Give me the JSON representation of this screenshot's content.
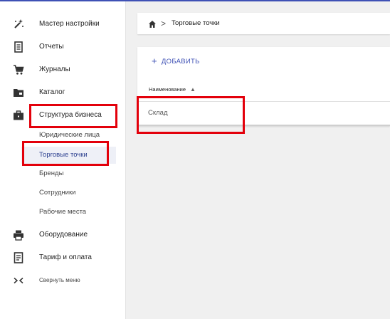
{
  "sidebar": {
    "items": [
      {
        "label": "Мастер настройки",
        "icon": "magic-wand-icon"
      },
      {
        "label": "Отчеты",
        "icon": "report-icon"
      },
      {
        "label": "Журналы",
        "icon": "cart-icon"
      },
      {
        "label": "Каталог",
        "icon": "folder-icon"
      },
      {
        "label": "Структура бизнеса",
        "icon": "briefcase-icon"
      },
      {
        "label": "Оборудование",
        "icon": "printer-icon"
      },
      {
        "label": "Тариф и оплата",
        "icon": "document-icon"
      },
      {
        "label": "Свернуть меню",
        "icon": "collapse-icon"
      }
    ],
    "subitems": [
      {
        "label": "Юридические лица"
      },
      {
        "label": "Торговые точки",
        "active": true
      },
      {
        "label": "Бренды"
      },
      {
        "label": "Сотрудники"
      },
      {
        "label": "Рабочие места"
      }
    ]
  },
  "breadcrumb": {
    "home_icon": "home-icon",
    "separator": ">",
    "current": "Торговые точки"
  },
  "toolbar": {
    "add_label": "ДОБАВИТЬ"
  },
  "table": {
    "columns": [
      {
        "label": "Наименование",
        "sort": "ascending"
      }
    ],
    "rows": [
      [
        "Склад"
      ]
    ]
  },
  "colors": {
    "accent": "#3f51b5",
    "highlight": "#e3000b",
    "active_bg": "#eef0f7",
    "background": "#f0f0f0"
  }
}
